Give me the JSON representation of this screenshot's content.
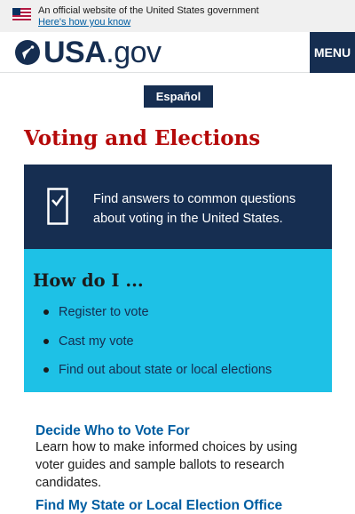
{
  "banner": {
    "text": "An official website of the United States government",
    "link": "Here's how you know"
  },
  "header": {
    "logo_main": "USA",
    "logo_suffix": ".gov",
    "menu_label": "MENU"
  },
  "language_toggle": "Español",
  "page": {
    "title": "Voting and Elections"
  },
  "intro": {
    "text": "Find answers to common questions about voting in the United States."
  },
  "how_do_i": {
    "title": "How do I ...",
    "items": [
      "Register to vote",
      "Cast my vote",
      "Find out about state or local elections"
    ]
  },
  "sections": [
    {
      "title": "Decide Who to Vote For",
      "description": "Learn how to make informed choices by using voter guides and sample ballots to research candidates."
    },
    {
      "title": "Find My State or Local Election Office"
    }
  ],
  "colors": {
    "navy": "#162e51",
    "cyan": "#1ec1e6",
    "title_red": "#b50909",
    "link_blue": "#005ea2"
  },
  "icons": {
    "flag": "us-flag-icon",
    "logo": "usa-star-icon",
    "intro": "checkbox-icon"
  }
}
